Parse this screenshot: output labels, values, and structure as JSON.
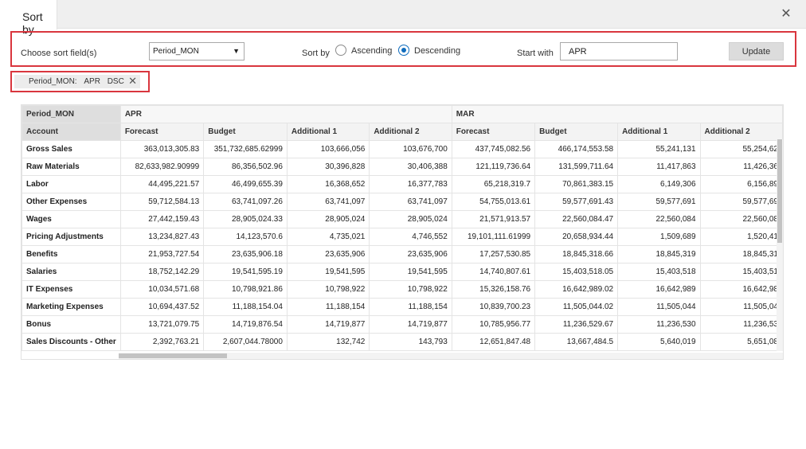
{
  "dialog": {
    "title": "Sort by",
    "close_glyph": "✕"
  },
  "controls": {
    "sort_field_label": "Choose sort field(s)",
    "sort_field_value": "Period_MON",
    "sort_by_label": "Sort by",
    "ascending_label": "Ascending",
    "descending_label": "Descending",
    "selected_order": "Descending",
    "start_with_label": "Start with",
    "start_with_value": "APR",
    "update_label": "Update"
  },
  "chip": {
    "field": "Period_MON:",
    "value": "APR",
    "order": "DSC",
    "remove_glyph": "✕"
  },
  "grid": {
    "corner_label": "Period_MON",
    "row_header_label": "Account",
    "periods": [
      "APR",
      "MAR"
    ],
    "measures": [
      "Forecast",
      "Budget",
      "Additional 1",
      "Additional 2"
    ],
    "rows": [
      {
        "account": "Gross Sales",
        "values": [
          "363,013,305.83",
          "351,732,685.62999",
          "103,666,056",
          "103,676,700",
          "437,745,082.56",
          "466,174,553.58",
          "55,241,131",
          "55,254,62"
        ]
      },
      {
        "account": "Raw Materials",
        "values": [
          "82,633,982.90999",
          "86,356,502.96",
          "30,396,828",
          "30,406,388",
          "121,119,736.64",
          "131,599,711.64",
          "11,417,863",
          "11,426,36"
        ]
      },
      {
        "account": "Labor",
        "values": [
          "44,495,221.57",
          "46,499,655.39",
          "16,368,652",
          "16,377,783",
          "65,218,319.7",
          "70,861,383.15",
          "6,149,306",
          "6,156,89"
        ]
      },
      {
        "account": "Other Expenses",
        "values": [
          "59,712,584.13",
          "63,741,097.26",
          "63,741,097",
          "63,741,097",
          "54,755,013.61",
          "59,577,691.43",
          "59,577,691",
          "59,577,69"
        ]
      },
      {
        "account": "Wages",
        "values": [
          "27,442,159.43",
          "28,905,024.33",
          "28,905,024",
          "28,905,024",
          "21,571,913.57",
          "22,560,084.47",
          "22,560,084",
          "22,560,08"
        ]
      },
      {
        "account": "Pricing Adjustments",
        "values": [
          "13,234,827.43",
          "14,123,570.6",
          "4,735,021",
          "4,746,552",
          "19,101,111.61999",
          "20,658,934.44",
          "1,509,689",
          "1,520,41"
        ]
      },
      {
        "account": "Benefits",
        "values": [
          "21,953,727.54",
          "23,635,906.18",
          "23,635,906",
          "23,635,906",
          "17,257,530.85",
          "18,845,318.66",
          "18,845,319",
          "18,845,31"
        ]
      },
      {
        "account": "Salaries",
        "values": [
          "18,752,142.29",
          "19,541,595.19",
          "19,541,595",
          "19,541,595",
          "14,740,807.61",
          "15,403,518.05",
          "15,403,518",
          "15,403,51"
        ]
      },
      {
        "account": "IT Expenses",
        "values": [
          "10,034,571.68",
          "10,798,921.86",
          "10,798,922",
          "10,798,922",
          "15,326,158.76",
          "16,642,989.02",
          "16,642,989",
          "16,642,98"
        ]
      },
      {
        "account": "Marketing Expenses",
        "values": [
          "10,694,437.52",
          "11,188,154.04",
          "11,188,154",
          "11,188,154",
          "10,839,700.23",
          "11,505,044.02",
          "11,505,044",
          "11,505,04"
        ]
      },
      {
        "account": "Bonus",
        "values": [
          "13,721,079.75",
          "14,719,876.54",
          "14,719,877",
          "14,719,877",
          "10,785,956.77",
          "11,236,529.67",
          "11,236,530",
          "11,236,53"
        ]
      },
      {
        "account": "Sales Discounts - Other",
        "values": [
          "2,392,763.21",
          "2,607,044.78000",
          "132,742",
          "143,793",
          "12,651,847.48",
          "13,667,484.5",
          "5,640,019",
          "5,651,08"
        ]
      }
    ]
  },
  "colors": {
    "highlight_border": "#d9363e",
    "radio_accent": "#0f6cbd"
  }
}
